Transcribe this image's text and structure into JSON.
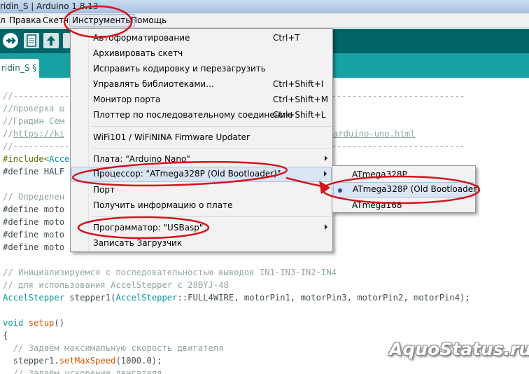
{
  "window": {
    "title": "ridin_S | Arduino 1.8.13"
  },
  "menubar": {
    "items": [
      {
        "label": "л"
      },
      {
        "label": "Правка"
      },
      {
        "label": "Скетч"
      },
      {
        "label": "Инструменты"
      },
      {
        "label": "Помощь"
      }
    ]
  },
  "toolbar": {
    "buttons": [
      "verify-icon",
      "upload-icon",
      "new-icon",
      "open-icon",
      "save-icon"
    ]
  },
  "tabs": [
    {
      "label": "ridin_S §"
    }
  ],
  "code": {
    "l1": "//----------------------------------------------------------------------------------------",
    "l2": "//проверка ш",
    "l3": "//Гридин Сем",
    "l4a": "//",
    "l4b": "https://ki",
    "l4c": "arduino-uno.html",
    "l5": "//----------------------------------------------------------------------------------------",
    "l6a": "#include<",
    "l6b": "Acce",
    "l7": "#define HALF",
    "l8": "// Определен",
    "l9": "#define moto",
    "l10": "#define moto",
    "l11": "#define moto",
    "l12": "#define moto",
    "l13": "// Инициализируемся с последовательностью выводов IN1-IN3-IN2-IN4",
    "l14": "// для использования AccelStepper с 28BYJ-48",
    "l15a": "AccelStepper",
    "l15b": " stepper1(",
    "l15c": "AccelStepper",
    "l15d": "::FULL4WIRE, motorPin1, motorPin3, motorPin2, motorPin4);",
    "l16a": "void",
    "l16b": " ",
    "l16c": "setup",
    "l16d": "()",
    "l17": "{",
    "l18": "  // Задаём максимальную скорость двигателя",
    "l19a": "  stepper1.",
    "l19b": "setMaxSpeed",
    "l19c": "(1000.0);",
    "l20": "  // Задаём ускорение двигателя"
  },
  "tools_menu": {
    "items": [
      {
        "label": "Автоформатирование",
        "shortcut": "Ctrl+T"
      },
      {
        "label": "Архивировать скетч",
        "shortcut": ""
      },
      {
        "label": "Исправить кодировку и перезагрузить",
        "shortcut": ""
      },
      {
        "label": "Управлять библиотеками...",
        "shortcut": "Ctrl+Shift+I"
      },
      {
        "label": "Монитор порта",
        "shortcut": "Ctrl+Shift+M"
      },
      {
        "label": "Плоттер по последовательному соединению",
        "shortcut": "Ctrl+Shift+L"
      },
      {
        "label": "WiFi101 / WiFiNINA Firmware Updater",
        "shortcut": ""
      },
      {
        "label": "Плата: \"Arduino Nano\"",
        "shortcut": ""
      },
      {
        "label": "Процессор: \"ATmega328P (Old Bootloader)\"",
        "shortcut": ""
      },
      {
        "label": "Порт",
        "shortcut": ""
      },
      {
        "label": "Получить информацию о плате",
        "shortcut": ""
      },
      {
        "label": "Программатор: \"USBasp\"",
        "shortcut": ""
      },
      {
        "label": "Записать Загрузчик",
        "shortcut": ""
      }
    ]
  },
  "processor_submenu": {
    "items": [
      {
        "label": "ATmega328P",
        "selected": false
      },
      {
        "label": "ATmega328P (Old Bootloader)",
        "selected": true
      },
      {
        "label": "ATmega168",
        "selected": false
      }
    ]
  },
  "annotation": {
    "color": "#d4141e"
  },
  "watermark": {
    "text": "AquoStatus.ru"
  }
}
